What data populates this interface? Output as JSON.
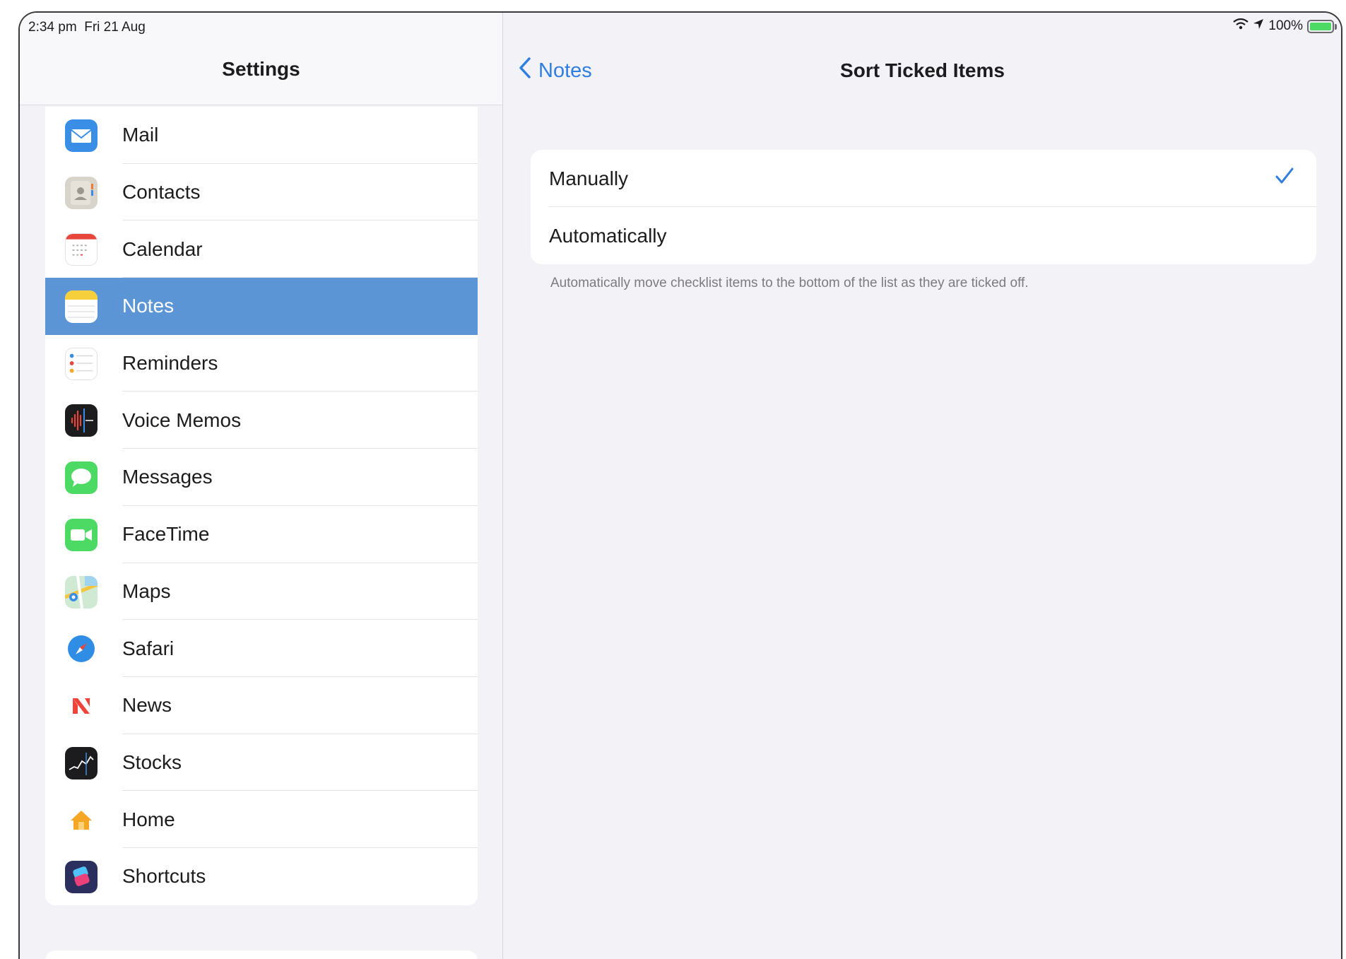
{
  "status_bar": {
    "time_date": "2:34 pm  Fri 21 Aug",
    "battery": "100%",
    "battery_level": 1.0
  },
  "sidebar": {
    "title": "Settings",
    "selected": "Notes",
    "items": [
      {
        "label": "Mail",
        "icon": "mail-icon",
        "color": "#3a8ee6"
      },
      {
        "label": "Contacts",
        "icon": "contacts-icon",
        "color": "#cfcac2"
      },
      {
        "label": "Calendar",
        "icon": "calendar-icon",
        "color": "#ffffff"
      },
      {
        "label": "Notes",
        "icon": "notes-icon",
        "color": "#f6cf3c"
      },
      {
        "label": "Reminders",
        "icon": "reminders-icon",
        "color": "#ffffff"
      },
      {
        "label": "Voice Memos",
        "icon": "voice-memos-icon",
        "color": "#1c1c1e"
      },
      {
        "label": "Messages",
        "icon": "messages-icon",
        "color": "#4cd964"
      },
      {
        "label": "FaceTime",
        "icon": "facetime-icon",
        "color": "#4cd964"
      },
      {
        "label": "Maps",
        "icon": "maps-icon",
        "color": "#8fd3a0"
      },
      {
        "label": "Safari",
        "icon": "safari-icon",
        "color": "#2f8de6"
      },
      {
        "label": "News",
        "icon": "news-icon",
        "color": "#ffffff"
      },
      {
        "label": "Stocks",
        "icon": "stocks-icon",
        "color": "#1c1c1e"
      },
      {
        "label": "Home",
        "icon": "home-icon",
        "color": "#ffffff"
      },
      {
        "label": "Shortcuts",
        "icon": "shortcuts-icon",
        "color": "#2a2f5e"
      }
    ]
  },
  "detail": {
    "back_label": "Notes",
    "title": "Sort Ticked Items",
    "options": [
      {
        "label": "Manually",
        "checked": true
      },
      {
        "label": "Automatically",
        "checked": false
      }
    ],
    "footer": "Automatically move checklist items to the bottom of the list as they are ticked off."
  },
  "colors": {
    "accent": "#2f7ee0",
    "selection": "#5b95d6",
    "background": "#f2f2f7"
  }
}
